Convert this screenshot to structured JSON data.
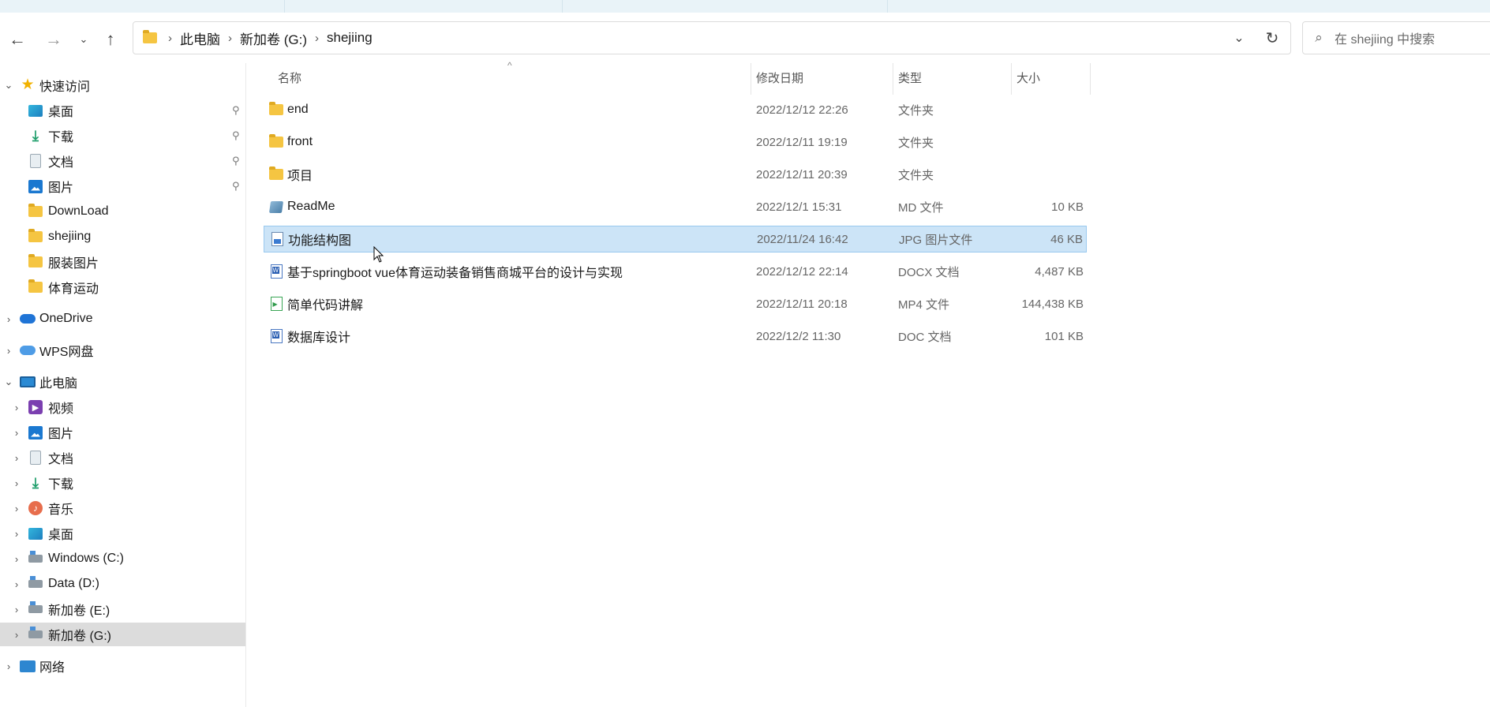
{
  "nav": {
    "back_icon": "arrow-left-icon",
    "forward_icon": "arrow-right-icon",
    "recent_icon": "chevron-down-icon",
    "up_icon": "arrow-up-icon"
  },
  "address": {
    "crumbs": [
      "此电脑",
      "新加卷 (G:)",
      "shejiing"
    ]
  },
  "search": {
    "placeholder": "在 shejiing 中搜索"
  },
  "sidebar": {
    "quick_access": "快速访问",
    "quick_items": [
      {
        "label": "桌面",
        "pinned": true
      },
      {
        "label": "下载",
        "pinned": true
      },
      {
        "label": "文档",
        "pinned": true
      },
      {
        "label": "图片",
        "pinned": true
      },
      {
        "label": "DownLoad",
        "pinned": false
      },
      {
        "label": "shejiing",
        "pinned": false
      },
      {
        "label": "服装图片",
        "pinned": false
      },
      {
        "label": "体育运动",
        "pinned": false
      }
    ],
    "onedrive": "OneDrive",
    "wps": "WPS网盘",
    "this_pc": "此电脑",
    "pc_items": [
      "视频",
      "图片",
      "文档",
      "下载",
      "音乐",
      "桌面",
      "Windows (C:)",
      "Data (D:)",
      "新加卷 (E:)",
      "新加卷 (G:)"
    ],
    "network": "网络",
    "selected": "新加卷 (G:)"
  },
  "columns": {
    "name": "名称",
    "modified": "修改日期",
    "type": "类型",
    "size": "大小"
  },
  "files": [
    {
      "name": "end",
      "modified": "2022/12/12 22:26",
      "type": "文件夹",
      "size": "",
      "icon": "folder-icon"
    },
    {
      "name": "front",
      "modified": "2022/12/11 19:19",
      "type": "文件夹",
      "size": "",
      "icon": "folder-icon"
    },
    {
      "name": "项目",
      "modified": "2022/12/11 20:39",
      "type": "文件夹",
      "size": "",
      "icon": "folder-icon"
    },
    {
      "name": "ReadMe",
      "modified": "2022/12/1 15:31",
      "type": "MD 文件",
      "size": "10 KB",
      "icon": "md-file-icon"
    },
    {
      "name": "功能结构图",
      "modified": "2022/11/24 16:42",
      "type": "JPG 图片文件",
      "size": "46 KB",
      "icon": "jpg-file-icon"
    },
    {
      "name": "基于springboot vue体育运动装备销售商城平台的设计与实现",
      "modified": "2022/12/12 22:14",
      "type": "DOCX 文档",
      "size": "4,487 KB",
      "icon": "docx-file-icon"
    },
    {
      "name": "简单代码讲解",
      "modified": "2022/12/11 20:18",
      "type": "MP4 文件",
      "size": "144,438 KB",
      "icon": "mp4-file-icon"
    },
    {
      "name": "数据库设计",
      "modified": "2022/12/2 11:30",
      "type": "DOC 文档",
      "size": "101 KB",
      "icon": "doc-file-icon"
    }
  ],
  "selected_file": "功能结构图"
}
